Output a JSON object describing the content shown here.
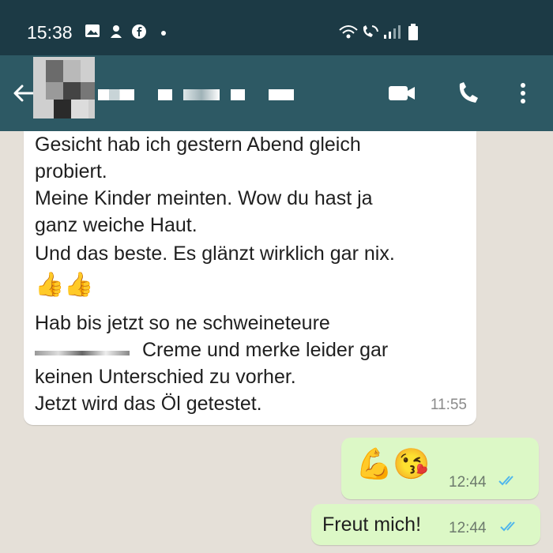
{
  "status_bar": {
    "time": "15:38",
    "left_icons": [
      "image-icon",
      "notification-icon",
      "facebook-icon",
      "dot-icon"
    ],
    "right_icons": [
      "wifi-icon",
      "call-icon",
      "signal-icon",
      "battery-icon"
    ]
  },
  "header": {
    "back_icon": "arrow-left-icon",
    "contact_name": "",
    "buttons": [
      "video-call-icon",
      "phone-call-icon",
      "more-vert-icon"
    ]
  },
  "messages": {
    "incoming": {
      "lines": [
        "Gesicht hab ich gestern Abend gleich",
        "probiert.",
        "Meine Kinder meinten. Wow du hast ja",
        "ganz weiche Haut.",
        "Und das beste. Es glänzt wirklich gar nix."
      ],
      "emoji": "👍👍",
      "lines2": [
        "Hab bis jetzt so ne schweineteure",
        "Creme und merke leider gar",
        "keinen Unterschied zu vorher.",
        "Jetzt wird das Öl getestet."
      ],
      "time": "11:55"
    },
    "outgoing": [
      {
        "emoji": "💪😘",
        "time": "12:44"
      },
      {
        "text": "Freut mich!",
        "time": "12:44"
      }
    ]
  },
  "colors": {
    "status_bar": "#1c3a45",
    "header": "#2d5964",
    "chat_bg": "#e5e0d8",
    "bubble_in": "#ffffff",
    "bubble_out": "#dcf8c6",
    "read_ticks": "#4fb6ec"
  }
}
